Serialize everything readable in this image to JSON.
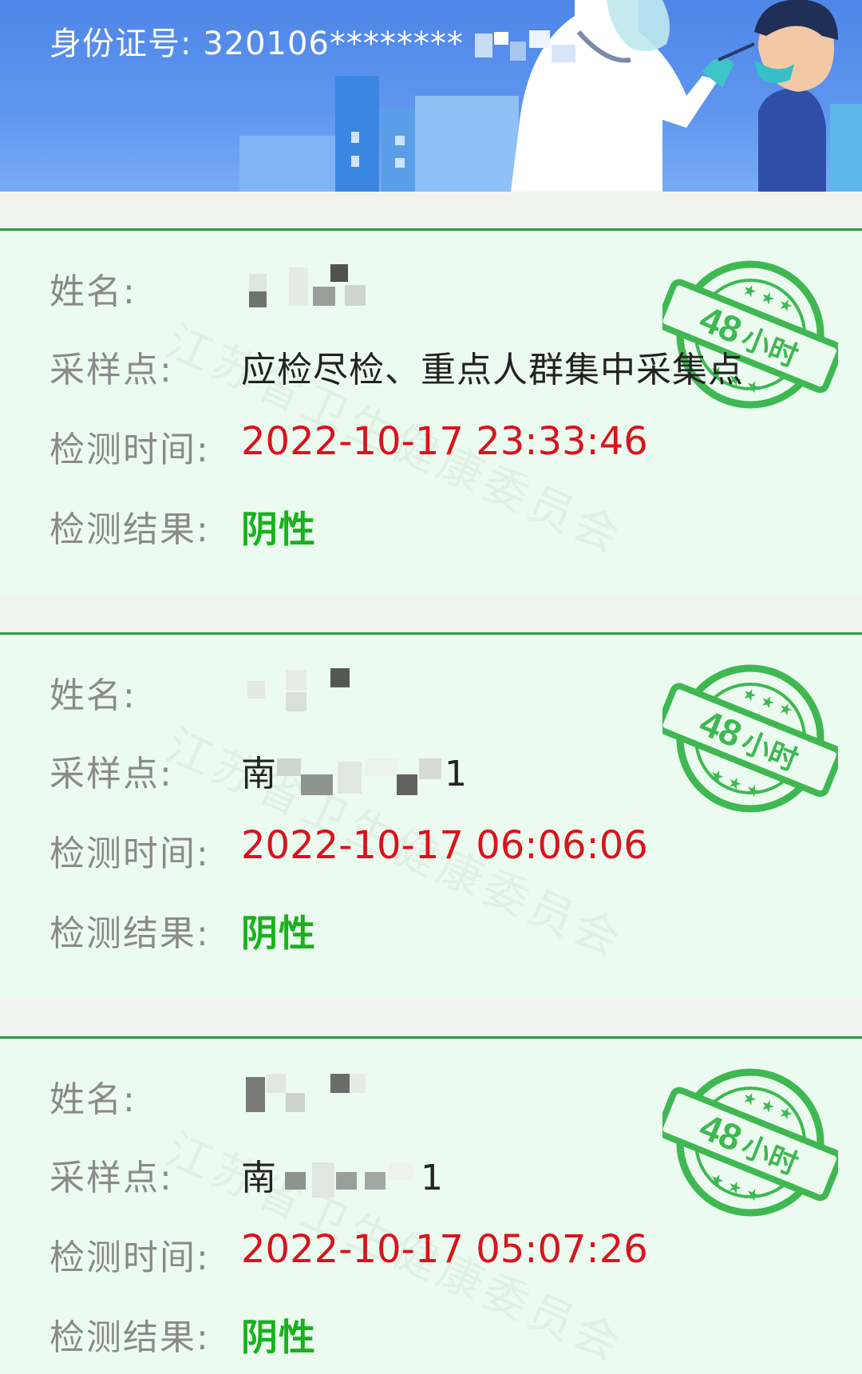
{
  "header": {
    "id_label": "身份证号:",
    "id_value": "320106********"
  },
  "colors": {
    "header_blue": "#5d95ef",
    "card_bg": "#ecfbef",
    "card_border": "#2e9a44",
    "time_red": "#d8141c",
    "result_green": "#19b21d",
    "stamp_green": "#3fb852"
  },
  "labels": {
    "name": "姓名:",
    "site": "采样点:",
    "time": "检测时间:",
    "result": "检测结果:"
  },
  "watermark": "江苏省卫生健康委员会",
  "stamp": {
    "hours": "48",
    "unit": "小时"
  },
  "records": [
    {
      "site": "应检尽检、重点人群集中采集点",
      "time": "2022-10-17 23:33:46",
      "result": "阴性"
    },
    {
      "site_start": "南",
      "site_end": "1",
      "time": "2022-10-17 06:06:06",
      "result": "阴性"
    },
    {
      "site_start": "南",
      "site_end": "1",
      "time": "2022-10-17 05:07:26",
      "result": "阴性"
    }
  ]
}
